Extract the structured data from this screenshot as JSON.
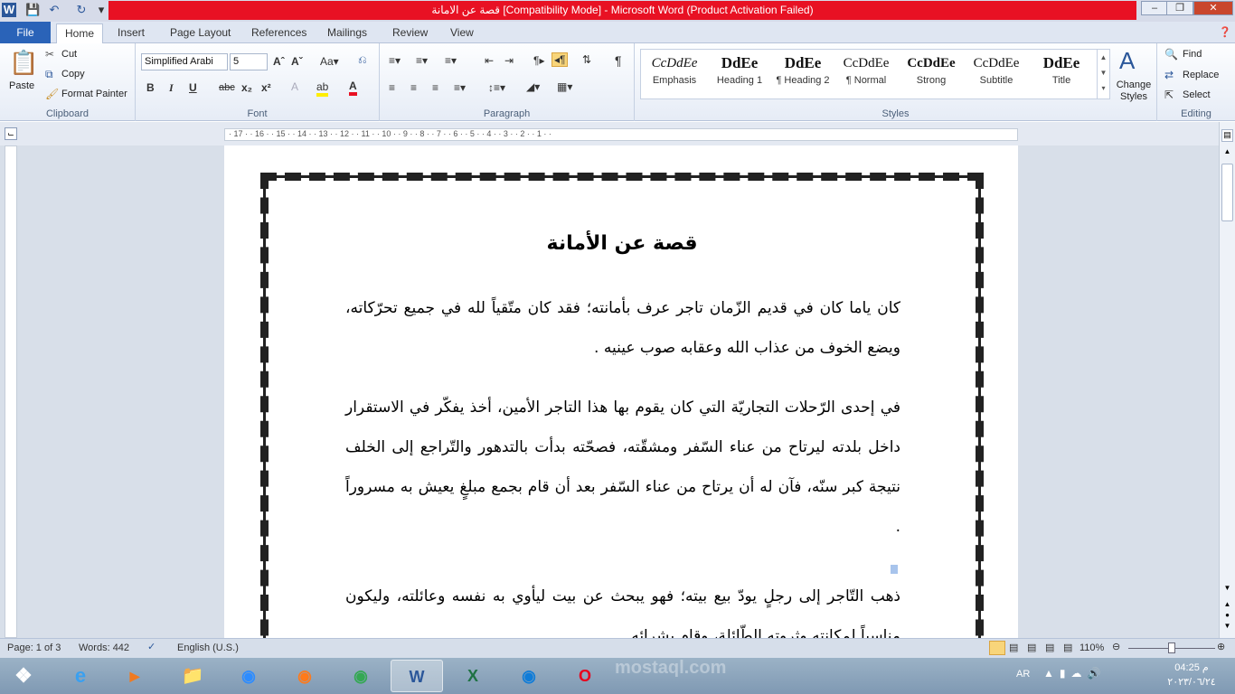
{
  "window": {
    "title": "قصة عن الامانة [Compatibility Mode] - Microsoft Word (Product Activation Failed)",
    "app_icon": "W"
  },
  "tabs": [
    "File",
    "Home",
    "Insert",
    "Page Layout",
    "References",
    "Mailings",
    "Review",
    "View"
  ],
  "clipboard": {
    "paste": "Paste",
    "cut": "Cut",
    "copy": "Copy",
    "format_painter": "Format Painter",
    "label": "Clipboard"
  },
  "font": {
    "name": "Simplified Arabi",
    "size": "5",
    "label": "Font"
  },
  "paragraph": {
    "label": "Paragraph"
  },
  "styles": {
    "label": "Styles",
    "items": [
      {
        "sample": "CcDdEe",
        "name": "Emphasis"
      },
      {
        "sample": "DdEe",
        "name": "Heading 1"
      },
      {
        "sample": "DdEe",
        "name": "¶ Heading 2"
      },
      {
        "sample": "CcDdEe",
        "name": "¶ Normal"
      },
      {
        "sample": "CcDdEe",
        "name": "Strong"
      },
      {
        "sample": "CcDdEe",
        "name": "Subtitle"
      },
      {
        "sample": "DdEe",
        "name": "Title"
      }
    ],
    "change_styles": "Change Styles"
  },
  "editing": {
    "find": "Find",
    "replace": "Replace",
    "select": "Select",
    "label": "Editing"
  },
  "ruler_ticks": "· 17 · · 16 · · 15 · · 14 · · 13 · · 12 · · 11 · · 10 · · 9 · · 8 · · 7 · · 6 · · 5 · · 4 · · 3 · · 2 · · 1 · ·",
  "document": {
    "title": "قصة عن الأمانة",
    "paragraphs": [
      "كان ياما كان في قديم الزّمان تاجر عرف بأمانته؛ فقد كان متّقياً لله في جميع تحرّكاته، ويضع الخوف من عذاب الله وعقابه صوب عينيه .",
      "في إحدى الرّحلات التجاريّة التي كان يقوم بها هذا التاجر الأمين، أخذ يفكّر في الاستقرار داخل بلدته ليرتاح من عناء السّفر ومشقّته، فصحّته بدأت بالتدهور والتّراجع إلى الخلف نتيجة كبر سنّه، فآن له أن يرتاح من عناء السّفر بعد أن قام بجمع مبلغٍ يعيش به مسروراً .",
      "ذهب التّاجر إلى رجلٍ يودّ بيع بيته؛ فهو يبحث عن بيت ليأوي به نفسه وعائلته، وليكون مناسباً لمكانته وثروته الطّائلة، وقام بشرائه ."
    ]
  },
  "status": {
    "page": "Page: 1 of 3",
    "words": "Words: 442",
    "language": "English (U.S.)",
    "zoom": "110%"
  },
  "taskbar": {
    "lang": "AR",
    "time": "04:25 م",
    "date": "٢٠٢٣/٠٦/٢٤",
    "watermark": "mostaql.com"
  }
}
